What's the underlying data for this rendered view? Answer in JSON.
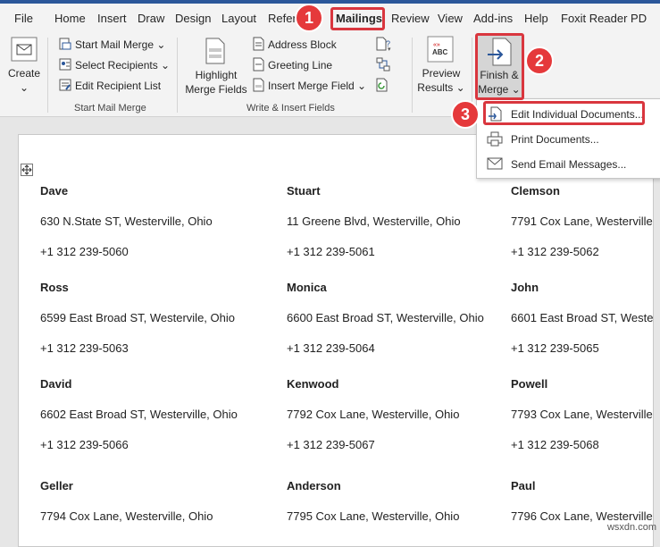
{
  "tabs": [
    "File",
    "Home",
    "Insert",
    "Draw",
    "Design",
    "Layout",
    "Refer",
    "Mailings",
    "Review",
    "View",
    "Add-ins",
    "Help",
    "Foxit Reader PD"
  ],
  "ribbon": {
    "create": {
      "label": "Create",
      "arrow": "⌄"
    },
    "start_mail_merge": {
      "label": "Start Mail Merge ⌄"
    },
    "select_recipients": {
      "label": "Select Recipients ⌄"
    },
    "edit_recipient_list": {
      "label": "Edit Recipient List"
    },
    "group_start": "Start Mail Merge",
    "highlight_merge_fields": {
      "line1": "Highlight",
      "line2": "Merge Fields"
    },
    "address_block": {
      "label": "Address Block"
    },
    "greeting_line": {
      "label": "Greeting Line"
    },
    "insert_merge_field": {
      "label": "Insert Merge Field  ⌄"
    },
    "group_write": "Write & Insert Fields",
    "preview_results": {
      "line1": "Preview",
      "line2": "Results ⌄",
      "icon_text": "ABC"
    },
    "finish_merge": {
      "line1": "Finish &",
      "line2": "Merge ⌄"
    }
  },
  "menu": {
    "items": [
      {
        "label": "Edit Individual Documents..."
      },
      {
        "label": "Print Documents..."
      },
      {
        "label": "Send Email Messages..."
      }
    ]
  },
  "badges": [
    "1",
    "2",
    "3"
  ],
  "records": [
    [
      {
        "name": "Dave",
        "address": "630 N.State ST, Westerville, Ohio",
        "phone": "+1 312 239-5060"
      },
      {
        "name": "Stuart",
        "address": "11 Greene Blvd, Westerville, Ohio",
        "phone": "+1 312 239-5061"
      },
      {
        "name": "Clemson",
        "address": "7791 Cox Lane, Westerville",
        "phone": "+1 312 239-5062"
      }
    ],
    [
      {
        "name": "Ross",
        "address": "6599 East Broad ST, Westervile, Ohio",
        "phone": "+1 312 239-5063"
      },
      {
        "name": "Monica",
        "address": "6600 East Broad ST, Westerville, Ohio",
        "phone": "+1 312 239-5064"
      },
      {
        "name": "John",
        "address": "6601 East Broad ST, Weste",
        "phone": "+1 312 239-5065"
      }
    ],
    [
      {
        "name": "David",
        "address": "6602 East Broad ST, Westerville, Ohio",
        "phone": "+1 312 239-5066"
      },
      {
        "name": "Kenwood",
        "address": "7792 Cox Lane, Westerville, Ohio",
        "phone": "+1 312 239-5067"
      },
      {
        "name": "Powell",
        "address": "7793 Cox Lane, Westerville",
        "phone": "+1 312 239-5068"
      }
    ],
    [
      {
        "name": "Geller",
        "address": "7794 Cox Lane, Westerville, Ohio"
      },
      {
        "name": "Anderson",
        "address": "7795 Cox Lane, Westerville, Ohio"
      },
      {
        "name": "Paul",
        "address": "7796 Cox Lane, Westerville"
      }
    ]
  ],
  "watermark": "wsxdn.com",
  "colors": {
    "accent": "#2b579a",
    "highlight": "#d9363e",
    "badge": "#e5393b"
  }
}
